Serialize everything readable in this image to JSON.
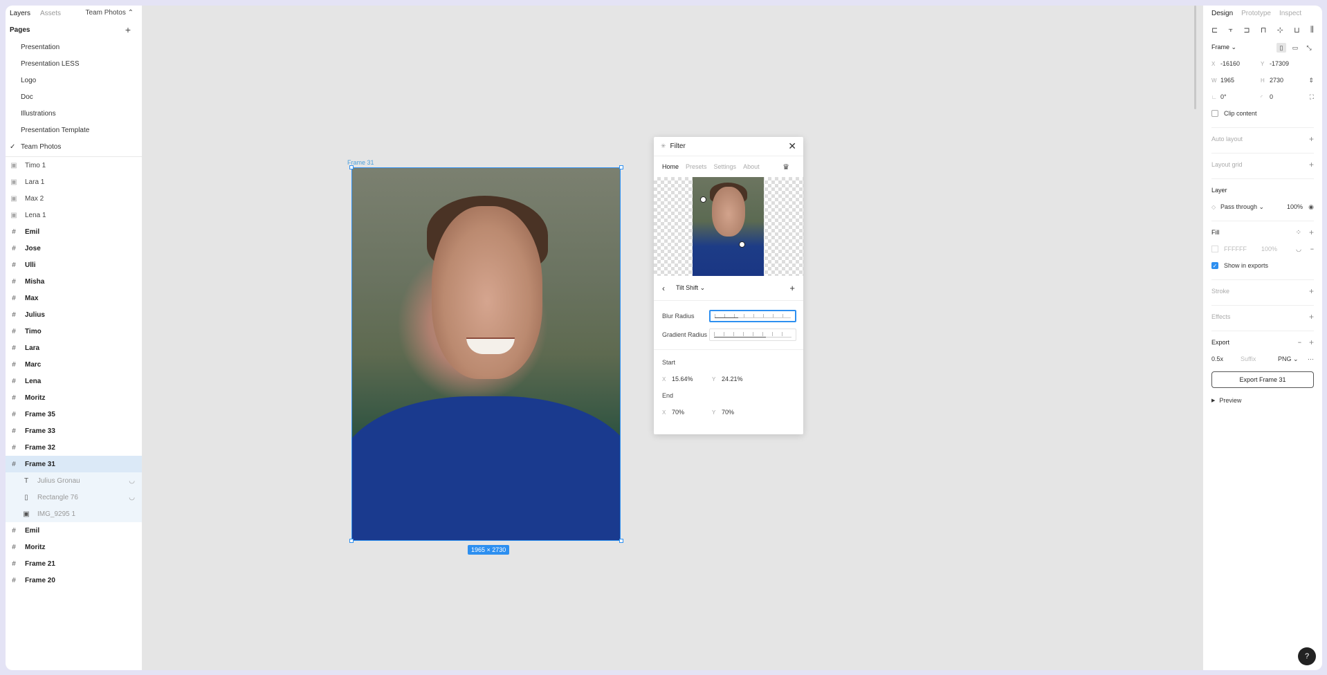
{
  "left_panel": {
    "tabs": [
      "Layers",
      "Assets"
    ],
    "team": "Team Photos ⌃",
    "pages_title": "Pages",
    "pages": [
      "Presentation",
      "Presentation LESS",
      "Logo",
      "Doc",
      "Illustrations",
      "Presentation Template",
      "Team Photos"
    ],
    "layers": [
      {
        "label": "Timo 1",
        "type": "img"
      },
      {
        "label": "Lara 1",
        "type": "img"
      },
      {
        "label": "Max 2",
        "type": "img"
      },
      {
        "label": "Lena 1",
        "type": "img"
      },
      {
        "label": "Emil",
        "type": "frame"
      },
      {
        "label": "Jose",
        "type": "frame"
      },
      {
        "label": "Ulli",
        "type": "frame"
      },
      {
        "label": "Misha",
        "type": "frame"
      },
      {
        "label": "Max",
        "type": "frame"
      },
      {
        "label": "Julius",
        "type": "frame"
      },
      {
        "label": "Timo",
        "type": "frame"
      },
      {
        "label": "Lara",
        "type": "frame"
      },
      {
        "label": "Marc",
        "type": "frame"
      },
      {
        "label": "Lena",
        "type": "frame"
      },
      {
        "label": "Moritz",
        "type": "frame"
      },
      {
        "label": "Frame 35",
        "type": "frame"
      },
      {
        "label": "Frame 33",
        "type": "frame"
      },
      {
        "label": "Frame 32",
        "type": "frame"
      },
      {
        "label": "Frame 31",
        "type": "frame",
        "selected": true
      },
      {
        "label": "Julius Gronau",
        "type": "child-text"
      },
      {
        "label": "Rectangle 76",
        "type": "child-rect"
      },
      {
        "label": "IMG_9295 1",
        "type": "child-img"
      },
      {
        "label": "Emil",
        "type": "frame"
      },
      {
        "label": "Moritz",
        "type": "frame"
      },
      {
        "label": "Frame 21",
        "type": "frame"
      },
      {
        "label": "Frame 20",
        "type": "frame"
      }
    ]
  },
  "canvas": {
    "frame_label": "Frame 31",
    "dimensions": "1965 × 2730"
  },
  "plugin": {
    "title": "Filter",
    "tabs": [
      "Home",
      "Presets",
      "Settings",
      "About"
    ],
    "filter_name": "Tilt Shift ⌄",
    "blur_label": "Blur Radius",
    "gradient_label": "Gradient Radius",
    "blur_level": 0.3,
    "gradient_level": 0.67,
    "start_label": "Start",
    "start_x": "15.64%",
    "start_y": "24.21%",
    "end_label": "End",
    "end_x": "70%",
    "end_y": "70%",
    "x_axis": "X",
    "y_axis": "Y"
  },
  "right_panel": {
    "tabs": [
      "Design",
      "Prototype",
      "Inspect"
    ],
    "frame_label": "Frame ⌄",
    "x": "-16160",
    "y": "-17309",
    "w": "1965",
    "h": "2730",
    "rotation": "0°",
    "radius": "0",
    "clip_content": "Clip content",
    "auto_layout": "Auto layout",
    "layout_grid": "Layout grid",
    "layer_title": "Layer",
    "blend": "Pass through ⌄",
    "layer_opacity": "100%",
    "fill_title": "Fill",
    "fill_hex": "FFFFFF",
    "fill_opacity": "100%",
    "show_exports": "Show in exports",
    "stroke": "Stroke",
    "effects": "Effects",
    "export_title": "Export",
    "export_scale": "0.5x",
    "suffix_placeholder": "Suffix",
    "export_format": "PNG ⌄",
    "export_button": "Export Frame 31",
    "preview": "Preview"
  },
  "help": "?",
  "colors": {
    "accent": "#2d8ff0",
    "canvas": "#e5e5e5"
  }
}
